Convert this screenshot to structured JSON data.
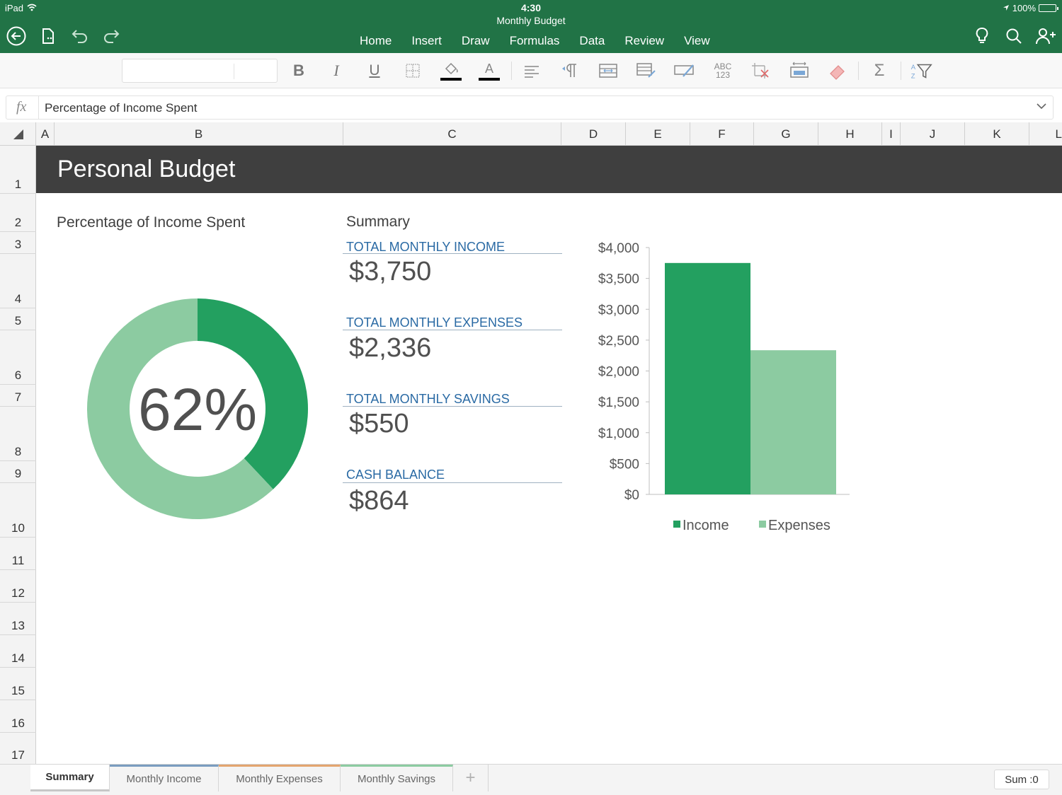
{
  "status_bar": {
    "device": "iPad",
    "time": "4:30",
    "battery": "100%",
    "battery_level": 1.0
  },
  "document": {
    "title": "Monthly Budget"
  },
  "ribbon": {
    "tabs": [
      {
        "label": "Home",
        "active": true
      },
      {
        "label": "Insert",
        "active": false
      },
      {
        "label": "Draw",
        "active": false
      },
      {
        "label": "Formulas",
        "active": false
      },
      {
        "label": "Data",
        "active": false
      },
      {
        "label": "Review",
        "active": false
      },
      {
        "label": "View",
        "active": false
      }
    ]
  },
  "toolbar": {
    "bold": "B",
    "italic": "I",
    "underline": "U",
    "fill_color": "#000000",
    "font_color": "#000000",
    "font_color_glyph": "A",
    "spelling_top": "ABC",
    "spelling_bottom": "123",
    "sum_glyph": "Σ",
    "sort_a": "A",
    "sort_z": "Z",
    "icons": [
      "back-icon",
      "file-icon",
      "undo-icon",
      "redo-icon",
      "lightbulb-icon",
      "search-icon",
      "share-icon",
      "borders-icon",
      "fill-color-icon",
      "font-color-icon",
      "align-icon",
      "wrap-text-icon",
      "merge-cells-icon",
      "format-cells-icon",
      "styles-icon",
      "spelling-icon",
      "clear-icon",
      "insert-delete-icon",
      "eraser-icon",
      "autosum-icon",
      "sort-filter-icon"
    ]
  },
  "formula_bar": {
    "fx_label": "fx",
    "content": "Percentage of Income Spent"
  },
  "grid": {
    "columns": [
      "A",
      "B",
      "C",
      "D",
      "E",
      "F",
      "G",
      "H",
      "I",
      "J",
      "K",
      "L"
    ],
    "rows": [
      "1",
      "2",
      "3",
      "4",
      "5",
      "6",
      "7",
      "8",
      "9",
      "10",
      "11",
      "12",
      "13",
      "14",
      "15",
      "16",
      "17"
    ]
  },
  "sheet": {
    "banner_title": "Personal Budget",
    "donut_title": "Percentage of Income Spent",
    "summary_title": "Summary",
    "kpis": [
      {
        "label": "TOTAL MONTHLY INCOME",
        "value": "$3,750"
      },
      {
        "label": "TOTAL MONTHLY EXPENSES",
        "value": "$2,336"
      },
      {
        "label": "TOTAL MONTHLY SAVINGS",
        "value": "$550"
      },
      {
        "label": "CASH BALANCE",
        "value": "$864"
      }
    ]
  },
  "chart_data": [
    {
      "type": "pie",
      "title": "",
      "center_label": "62%",
      "slices": [
        {
          "value": 62,
          "color": "#8CCBA1"
        },
        {
          "value": 38,
          "color": "#23A060"
        }
      ]
    },
    {
      "type": "bar",
      "categories": [
        "Income",
        "Expenses"
      ],
      "values": [
        3750,
        2336
      ],
      "colors": [
        "#23A060",
        "#8CCBA1"
      ],
      "ylim": [
        0,
        4000
      ],
      "yticks": [
        "$0",
        "$500",
        "$1,000",
        "$1,500",
        "$2,000",
        "$2,500",
        "$3,000",
        "$3,500",
        "$4,000"
      ],
      "legend": [
        "Income",
        "Expenses"
      ],
      "legend_position": "bottom",
      "grid": false
    }
  ],
  "sheet_tabs": [
    {
      "label": "Summary",
      "active": true,
      "accent": "#c7c7c7"
    },
    {
      "label": "Monthly Income",
      "active": false,
      "accent": "#7a9cbf"
    },
    {
      "label": "Monthly Expenses",
      "active": false,
      "accent": "#e3a56f"
    },
    {
      "label": "Monthly Savings",
      "active": false,
      "accent": "#8ccba1"
    }
  ],
  "status": {
    "sum": "Sum :0"
  },
  "colors": {
    "brand": "#217346",
    "banner": "#3F3F3F",
    "kpi_label": "#2A6AA4"
  }
}
